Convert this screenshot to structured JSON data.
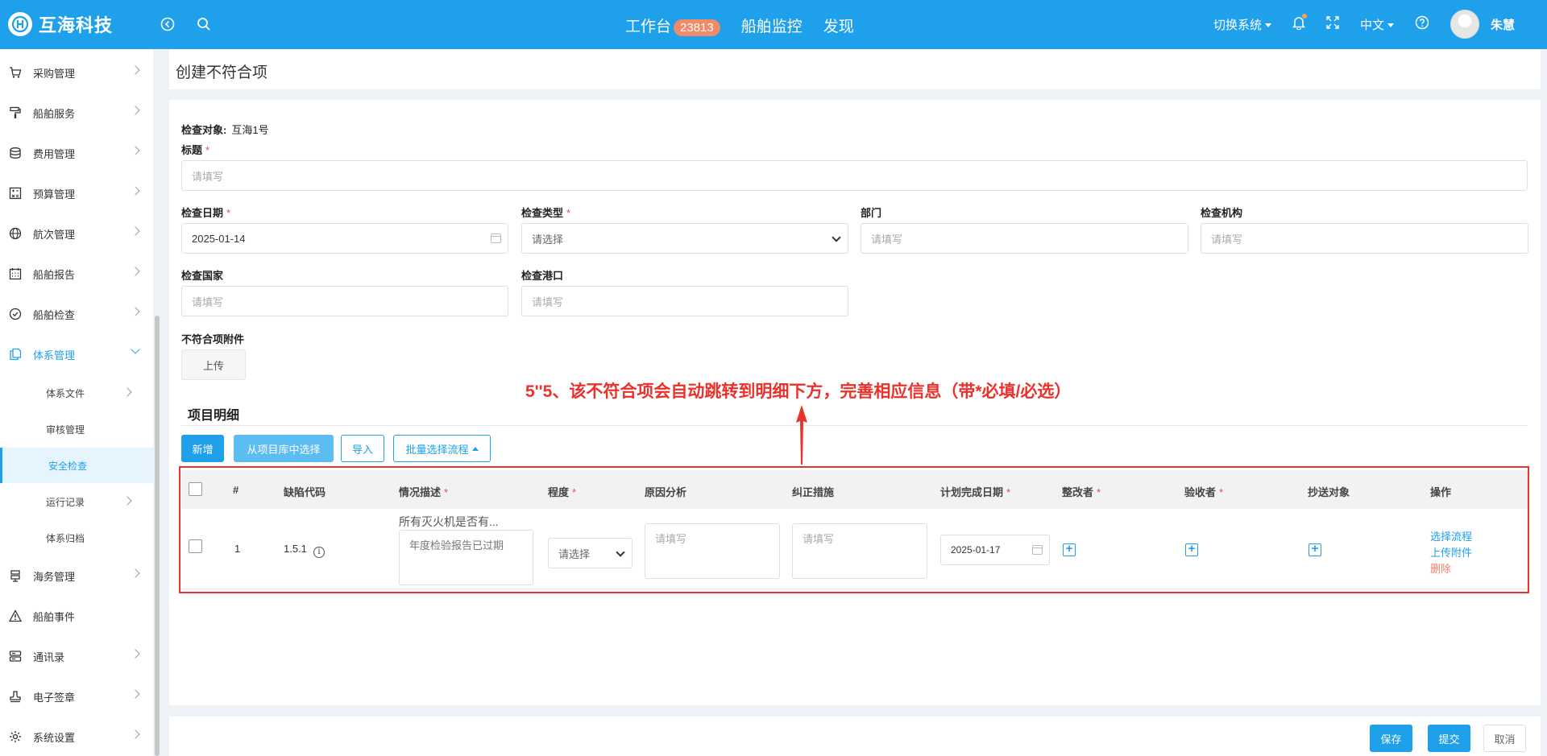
{
  "brand": {
    "name": "互海科技"
  },
  "topnav": {
    "workbench": "工作台",
    "workbench_count": "23813",
    "ship_monitor": "船舶监控",
    "discover": "发现"
  },
  "topright": {
    "switch_system": "切换系统",
    "language": "中文",
    "user_name": "朱慧"
  },
  "sidebar": {
    "items": [
      {
        "label": "采购管理",
        "icon": "cart-icon"
      },
      {
        "label": "船舶服务",
        "icon": "paint-roller-icon"
      },
      {
        "label": "费用管理",
        "icon": "coins-icon"
      },
      {
        "label": "预算管理",
        "icon": "calculator-icon"
      },
      {
        "label": "航次管理",
        "icon": "globe-icon"
      },
      {
        "label": "船舶报告",
        "icon": "calendar-icon"
      },
      {
        "label": "船舶检查",
        "icon": "check-circle-icon"
      },
      {
        "label": "体系管理",
        "icon": "documents-icon"
      },
      {
        "label": "海务管理",
        "icon": "signpost-icon"
      },
      {
        "label": "船舶事件",
        "icon": "warning-icon"
      },
      {
        "label": "通讯录",
        "icon": "server-icon"
      },
      {
        "label": "电子签章",
        "icon": "stamp-icon"
      },
      {
        "label": "系统设置",
        "icon": "gear-icon"
      }
    ],
    "sub_items": [
      {
        "label": "体系文件"
      },
      {
        "label": "审核管理"
      },
      {
        "label": "安全检查"
      },
      {
        "label": "运行记录"
      },
      {
        "label": "体系归档"
      }
    ]
  },
  "page": {
    "title": "创建不符合项"
  },
  "form": {
    "inspect_target_label": "检查对象:",
    "inspect_target_value": "互海1号",
    "title_label": "标题",
    "title_placeholder": "请填写",
    "date_label": "检查日期",
    "date_value": "2025-01-14",
    "type_label": "检查类型",
    "type_placeholder": "请选择",
    "dept_label": "部门",
    "dept_placeholder": "请填写",
    "org_label": "检查机构",
    "org_placeholder": "请填写",
    "country_label": "检查国家",
    "country_placeholder": "请填写",
    "port_label": "检查港口",
    "port_placeholder": "请填写",
    "attach_label": "不符合项附件",
    "upload_button": "上传"
  },
  "details": {
    "section_title": "项目明细",
    "annotation": "5''5、该不符合项会自动跳转到明细下方，完善相应信息（带*必填/必选）",
    "btn_add": "新增",
    "btn_from_library": "从项目库中选择",
    "btn_import": "导入",
    "btn_batch_flow": "批量选择流程",
    "columns": {
      "index": "#",
      "defect_code": "缺陷代码",
      "description": "情况描述",
      "severity": "程度",
      "cause": "原因分析",
      "corrective": "纠正措施",
      "plan_date": "计划完成日期",
      "rectifier": "整改者",
      "acceptor": "验收者",
      "cc": "抄送对象",
      "action": "操作"
    },
    "rows": [
      {
        "index": "1",
        "defect_code": "1.5.1",
        "desc_title": "所有灭火机是否有...",
        "desc_value": "年度检验报告已过期",
        "severity_placeholder": "请选择",
        "cause_placeholder": "请填写",
        "corrective_placeholder": "请填写",
        "plan_date": "2025-01-17",
        "action_select_flow": "选择流程",
        "action_upload": "上传附件",
        "action_delete": "删除"
      }
    ]
  },
  "footer": {
    "save": "保存",
    "submit": "提交",
    "cancel": "取消"
  },
  "colors": {
    "brand": "#1ea0ea",
    "annotation": "#e8322b",
    "badge": "#f08a68",
    "danger": "#f3826c"
  }
}
